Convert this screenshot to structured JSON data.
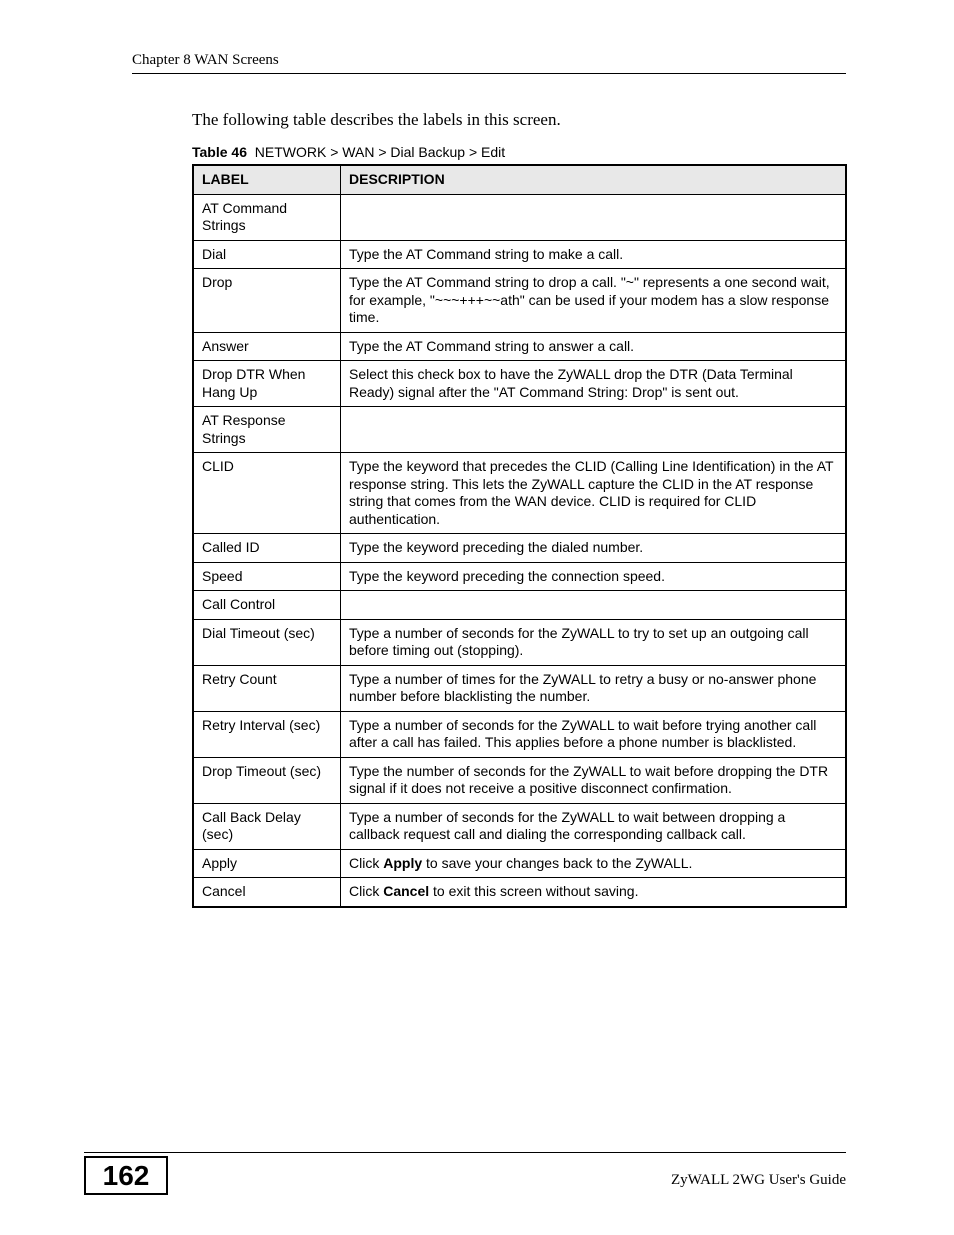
{
  "header": {
    "chapter": "Chapter 8 WAN Screens"
  },
  "intro_text": "The following table describes the labels in this screen.",
  "caption": {
    "label": "Table 46",
    "text": "NETWORK > WAN > Dial Backup > Edit"
  },
  "table": {
    "columns": {
      "label": "LABEL",
      "description": "DESCRIPTION"
    },
    "rows": [
      {
        "label": "AT Command Strings",
        "desc": ""
      },
      {
        "label": "Dial",
        "desc": "Type the AT Command string to make a call."
      },
      {
        "label": "Drop",
        "desc": "Type the AT Command string to drop a call. \"~\" represents a one second wait, for example, \"~~~+++~~ath\" can be used if your modem has a slow response time."
      },
      {
        "label": "Answer",
        "desc": "Type the AT Command string to answer a call."
      },
      {
        "label": "Drop DTR When Hang Up",
        "desc": "Select this check box to have the ZyWALL drop the DTR (Data Terminal Ready) signal after the \"AT Command String: Drop\" is sent out."
      },
      {
        "label": "AT Response Strings",
        "desc": ""
      },
      {
        "label": "CLID",
        "desc": "Type the keyword that precedes the CLID (Calling Line Identification) in the AT response string. This lets the ZyWALL capture the CLID in the AT response string that comes from the WAN device. CLID is required for CLID authentication."
      },
      {
        "label": "Called ID",
        "desc": "Type the keyword preceding the dialed number."
      },
      {
        "label": "Speed",
        "desc": "Type the keyword preceding the connection speed."
      },
      {
        "label": "Call Control",
        "desc": ""
      },
      {
        "label": "Dial Timeout (sec)",
        "desc": "Type a number of seconds for the ZyWALL to try to set up an outgoing call before timing out (stopping)."
      },
      {
        "label": "Retry Count",
        "desc": "Type a number of times for the ZyWALL to retry a busy or no-answer phone number before blacklisting the number."
      },
      {
        "label": "Retry Interval (sec)",
        "desc": "Type a number of seconds for the ZyWALL to wait before trying another call after a call has failed. This applies before a phone number is blacklisted."
      },
      {
        "label": "Drop Timeout (sec)",
        "desc": "Type the number of seconds for the ZyWALL to wait before dropping the DTR signal if it does not receive a positive disconnect confirmation."
      },
      {
        "label": "Call Back Delay (sec)",
        "desc": "Type a number of seconds for the ZyWALL to wait between dropping a callback request call and dialing the corresponding callback call."
      },
      {
        "label": "Apply",
        "desc_parts": [
          "Click ",
          "Apply",
          " to save your changes back to the ZyWALL."
        ]
      },
      {
        "label": "Cancel",
        "desc_parts": [
          "Click ",
          "Cancel",
          " to exit this screen without saving."
        ]
      }
    ]
  },
  "footer": {
    "page_number": "162",
    "guide": "ZyWALL 2WG User's Guide"
  }
}
